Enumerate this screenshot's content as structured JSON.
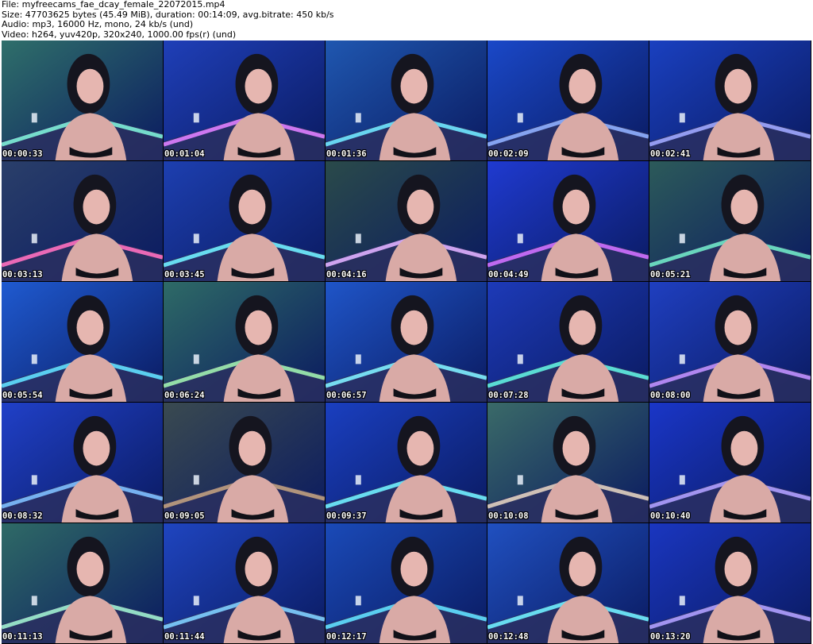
{
  "header": {
    "file_line": "File: myfreecams_fae_dcay_female_22072015.mp4",
    "size_line": "Size: 47703625 bytes (45.49 MiB), duration: 00:14:09, avg.bitrate: 450 kb/s",
    "audio_line": "Audio: mp3, 16000 Hz, mono, 24 kb/s (und)",
    "video_line": "Video: h264, yuv420p, 320x240, 1000.00 fps(r) (und)"
  },
  "thumbnails": [
    {
      "timestamp": "00:00:33",
      "wall": "#2f6f6a",
      "glow": "#7ef0d8"
    },
    {
      "timestamp": "00:01:04",
      "wall": "#1f3fb8",
      "glow": "#e080ff"
    },
    {
      "timestamp": "00:01:36",
      "wall": "#1f57b0",
      "glow": "#70e8ff"
    },
    {
      "timestamp": "00:02:09",
      "wall": "#1a48c8",
      "glow": "#90b0ff"
    },
    {
      "timestamp": "00:02:41",
      "wall": "#1a40c0",
      "glow": "#a0a8ff"
    },
    {
      "timestamp": "00:03:13",
      "wall": "#2a3f6a",
      "glow": "#ff70c0"
    },
    {
      "timestamp": "00:03:45",
      "wall": "#1d3fb0",
      "glow": "#70f0ff"
    },
    {
      "timestamp": "00:04:16",
      "wall": "#2a4a4a",
      "glow": "#e0b0ff"
    },
    {
      "timestamp": "00:04:49",
      "wall": "#1f3ad0",
      "glow": "#d070ff"
    },
    {
      "timestamp": "00:05:21",
      "wall": "#2c5a5a",
      "glow": "#70e8c8"
    },
    {
      "timestamp": "00:05:54",
      "wall": "#1f5ad0",
      "glow": "#60e0ff"
    },
    {
      "timestamp": "00:06:24",
      "wall": "#2e6a66",
      "glow": "#a0f0b0"
    },
    {
      "timestamp": "00:06:57",
      "wall": "#1f55c8",
      "glow": "#80f0ff"
    },
    {
      "timestamp": "00:07:28",
      "wall": "#1d3ab8",
      "glow": "#60f0e0"
    },
    {
      "timestamp": "00:08:00",
      "wall": "#1f3fc0",
      "glow": "#c090ff"
    },
    {
      "timestamp": "00:08:32",
      "wall": "#2040c8",
      "glow": "#80c0ff"
    },
    {
      "timestamp": "00:09:05",
      "wall": "#3a4a50",
      "glow": "#c0a080"
    },
    {
      "timestamp": "00:09:37",
      "wall": "#1a3fc0",
      "glow": "#70f0ff"
    },
    {
      "timestamp": "00:10:08",
      "wall": "#3a6a68",
      "glow": "#e0d0c0"
    },
    {
      "timestamp": "00:10:40",
      "wall": "#1a36c8",
      "glow": "#b0a0ff"
    },
    {
      "timestamp": "00:11:13",
      "wall": "#2f6a66",
      "glow": "#a0f0d0"
    },
    {
      "timestamp": "00:11:44",
      "wall": "#1f45c0",
      "glow": "#80d0ff"
    },
    {
      "timestamp": "00:12:17",
      "wall": "#1a4ab8",
      "glow": "#60e0ff"
    },
    {
      "timestamp": "00:12:48",
      "wall": "#2050c0",
      "glow": "#70f0ff"
    },
    {
      "timestamp": "00:13:20",
      "wall": "#1a36c0",
      "glow": "#b0a0ff"
    }
  ]
}
